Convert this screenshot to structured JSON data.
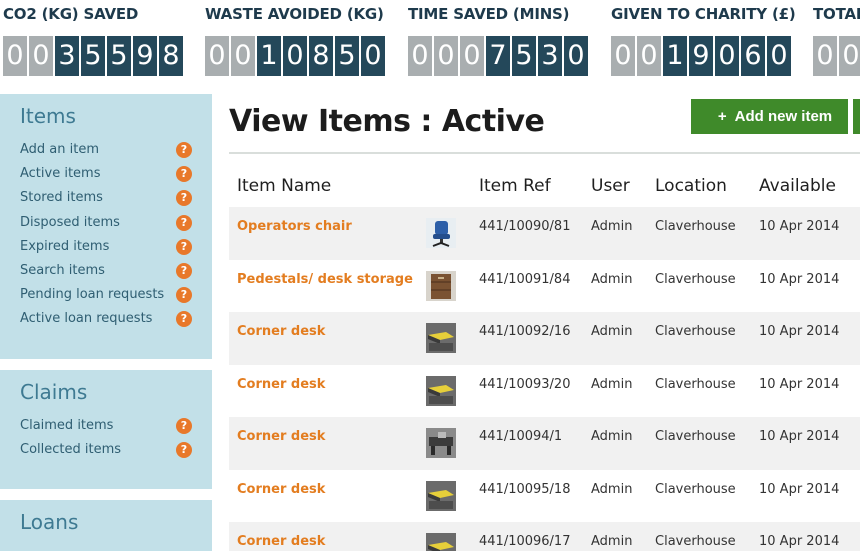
{
  "counters": [
    {
      "title": "CO2 (KG) SAVED",
      "digits": [
        "0",
        "0",
        "3",
        "5",
        "5",
        "9",
        "8"
      ],
      "lead_zeros": 2
    },
    {
      "title": "WASTE AVOIDED (KG)",
      "digits": [
        "0",
        "0",
        "1",
        "0",
        "8",
        "5",
        "0"
      ],
      "lead_zeros": 2
    },
    {
      "title": "TIME SAVED (MINS)",
      "digits": [
        "0",
        "0",
        "0",
        "7",
        "5",
        "3",
        "0"
      ],
      "lead_zeros": 3
    },
    {
      "title": "GIVEN TO CHARITY (£)",
      "digits": [
        "0",
        "0",
        "1",
        "9",
        "0",
        "6",
        "0"
      ],
      "lead_zeros": 2
    },
    {
      "title": "TOTAL",
      "digits": [
        "0",
        "0"
      ],
      "lead_zeros": 2
    }
  ],
  "sidebar": {
    "items_section": {
      "title": "Items",
      "links": [
        "Add an item",
        "Active items",
        "Stored items",
        "Disposed items",
        "Expired items",
        "Search items",
        "Pending loan requests",
        "Active loan requests"
      ]
    },
    "claims_section": {
      "title": "Claims",
      "links": [
        "Claimed items",
        "Collected items"
      ]
    },
    "loans_section": {
      "title": "Loans"
    },
    "help_glyph": "?"
  },
  "main": {
    "title": "View Items : Active",
    "add_button": {
      "icon": "+",
      "label": "Add new item"
    },
    "columns": [
      "Item Name",
      "Item Ref",
      "User",
      "Location",
      "Available"
    ],
    "rows": [
      {
        "name": "Operators chair",
        "thumb": "chair-thumbnail",
        "ref": "441/10090/81",
        "user": "Admin",
        "location": "Claverhouse",
        "available": "10 Apr 2014"
      },
      {
        "name": "Pedestals/ desk storage",
        "thumb": "pedestal-thumbnail",
        "ref": "441/10091/84",
        "user": "Admin",
        "location": "Claverhouse",
        "available": "10 Apr 2014"
      },
      {
        "name": "Corner desk",
        "thumb": "desk-thumbnail",
        "ref": "441/10092/16",
        "user": "Admin",
        "location": "Claverhouse",
        "available": "10 Apr 2014"
      },
      {
        "name": "Corner desk",
        "thumb": "desk-thumbnail",
        "ref": "441/10093/20",
        "user": "Admin",
        "location": "Claverhouse",
        "available": "10 Apr 2014"
      },
      {
        "name": "Corner desk",
        "thumb": "desk-photo-thumbnail",
        "ref": "441/10094/1",
        "user": "Admin",
        "location": "Claverhouse",
        "available": "10 Apr 2014"
      },
      {
        "name": "Corner desk",
        "thumb": "desk-thumbnail",
        "ref": "441/10095/18",
        "user": "Admin",
        "location": "Claverhouse",
        "available": "10 Apr 2014"
      },
      {
        "name": "Corner desk",
        "thumb": "desk-thumbnail",
        "ref": "441/10096/17",
        "user": "Admin",
        "location": "Claverhouse",
        "available": "10 Apr 2014"
      }
    ]
  },
  "colors": {
    "counter_value_bg": "#24485a",
    "counter_zero_bg": "#a9aeb0",
    "sidebar_bg": "#c2e0e8",
    "link_orange": "#e37d20",
    "button_green": "#3f8a2a",
    "help_badge": "#e8782a"
  }
}
